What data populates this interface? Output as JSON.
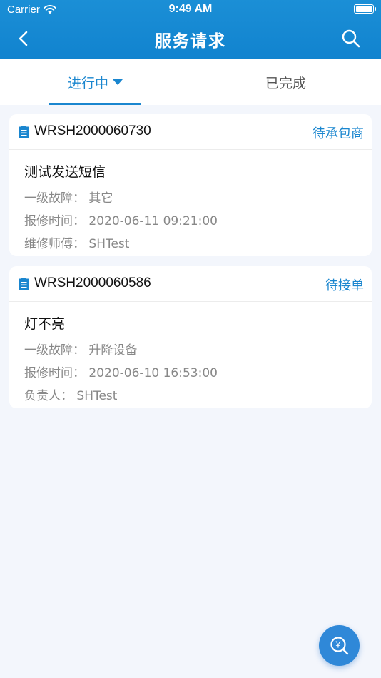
{
  "status_bar": {
    "carrier": "Carrier",
    "time": "9:49 AM"
  },
  "nav": {
    "title": "服务请求",
    "back_icon": "chevron-left-icon",
    "search_icon": "search-icon"
  },
  "tabs": [
    {
      "label": "进行中",
      "active": true
    },
    {
      "label": "已完成",
      "active": false
    }
  ],
  "cards": [
    {
      "ticket_no": "WRSH2000060730",
      "status": "待承包商",
      "title": "测试发送短信",
      "lines": [
        {
          "label": "一级故障：",
          "value": "其它"
        },
        {
          "label": "报修时间：",
          "value": "2020-06-11 09:21:00"
        },
        {
          "label": "维修师傅：",
          "value": "SHTest"
        }
      ]
    },
    {
      "ticket_no": "WRSH2000060586",
      "status": "待接单",
      "title": "灯不亮",
      "lines": [
        {
          "label": "一级故障：",
          "value": "升降设备"
        },
        {
          "label": "报修时间：",
          "value": "2020-06-10 16:53:00"
        },
        {
          "label": "负责人：",
          "value": "SHTest"
        }
      ]
    }
  ],
  "fab": {
    "icon": "yen-search-icon",
    "symbol": "¥"
  },
  "colors": {
    "brand": "#1a86cf",
    "background": "#f3f6fc",
    "fab": "#2f88d8"
  }
}
